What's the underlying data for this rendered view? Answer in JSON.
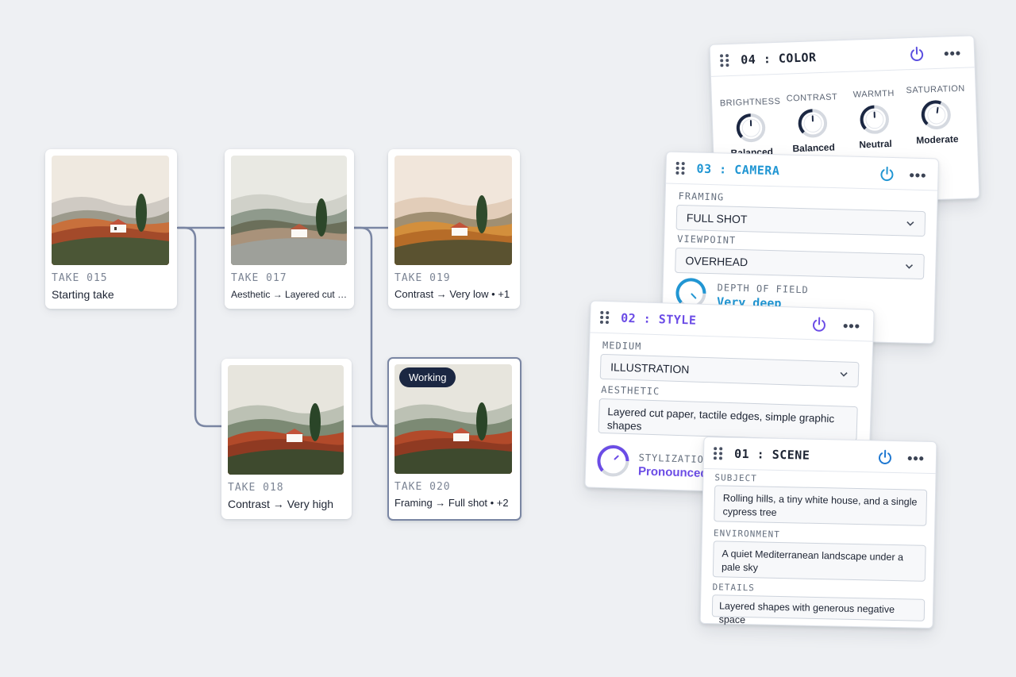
{
  "canvas": {
    "takes": [
      {
        "id": "TAKE 015",
        "desc": "Starting take"
      },
      {
        "id": "TAKE 017",
        "desc": "Aesthetic → Layered cut pa..."
      },
      {
        "id": "TAKE 019",
        "desc": "Contrast → Very low • +1"
      },
      {
        "id": "TAKE 018",
        "desc": "Contrast → Very high"
      },
      {
        "id": "TAKE 020",
        "desc": "Framing → Full shot • +2",
        "badge": "Working"
      }
    ]
  },
  "panels": {
    "color": {
      "number": "04",
      "sep": ":",
      "title": "COLOR",
      "knobs": [
        {
          "label": "BRIGHTNESS",
          "value": "Balanced"
        },
        {
          "label": "CONTRAST",
          "value": "Balanced"
        },
        {
          "label": "WARMTH",
          "value": "Neutral"
        },
        {
          "label": "SATURATION",
          "value": "Moderate"
        }
      ]
    },
    "camera": {
      "number": "03",
      "sep": ":",
      "title": "CAMERA",
      "framing_label": "FRAMING",
      "framing_value": "FULL SHOT",
      "viewpoint_label": "VIEWPOINT",
      "viewpoint_value": "OVERHEAD",
      "dof_label": "DEPTH OF FIELD",
      "dof_value": "Very deep"
    },
    "style": {
      "number": "02",
      "sep": ":",
      "title": "STYLE",
      "medium_label": "MEDIUM",
      "medium_value": "ILLUSTRATION",
      "aesthetic_label": "AESTHETIC",
      "aesthetic_value": "Layered cut paper, tactile edges, simple graphic shapes",
      "stylization_label": "STYLIZATION",
      "stylization_value": "Pronounced"
    },
    "scene": {
      "number": "01",
      "sep": ":",
      "title": "SCENE",
      "subject_label": "SUBJECT",
      "subject_value": "Rolling hills, a tiny white house, and a single cypress tree",
      "environment_label": "ENVIRONMENT",
      "environment_value": "A quiet Mediterranean landscape under a pale sky",
      "details_label": "DETAILS",
      "details_value": "Layered shapes with generous negative space"
    }
  },
  "colors": {
    "color_accent": "#5b4fe0",
    "camera_accent": "#2196d3",
    "style_accent": "#6b4ce6",
    "scene_accent": "#1f78d1",
    "connector": "#7a86a3",
    "badge_bg": "#1b2742"
  },
  "icons": [
    "drag-handle-icon",
    "power-icon",
    "more-icon",
    "chevron-down-icon"
  ]
}
